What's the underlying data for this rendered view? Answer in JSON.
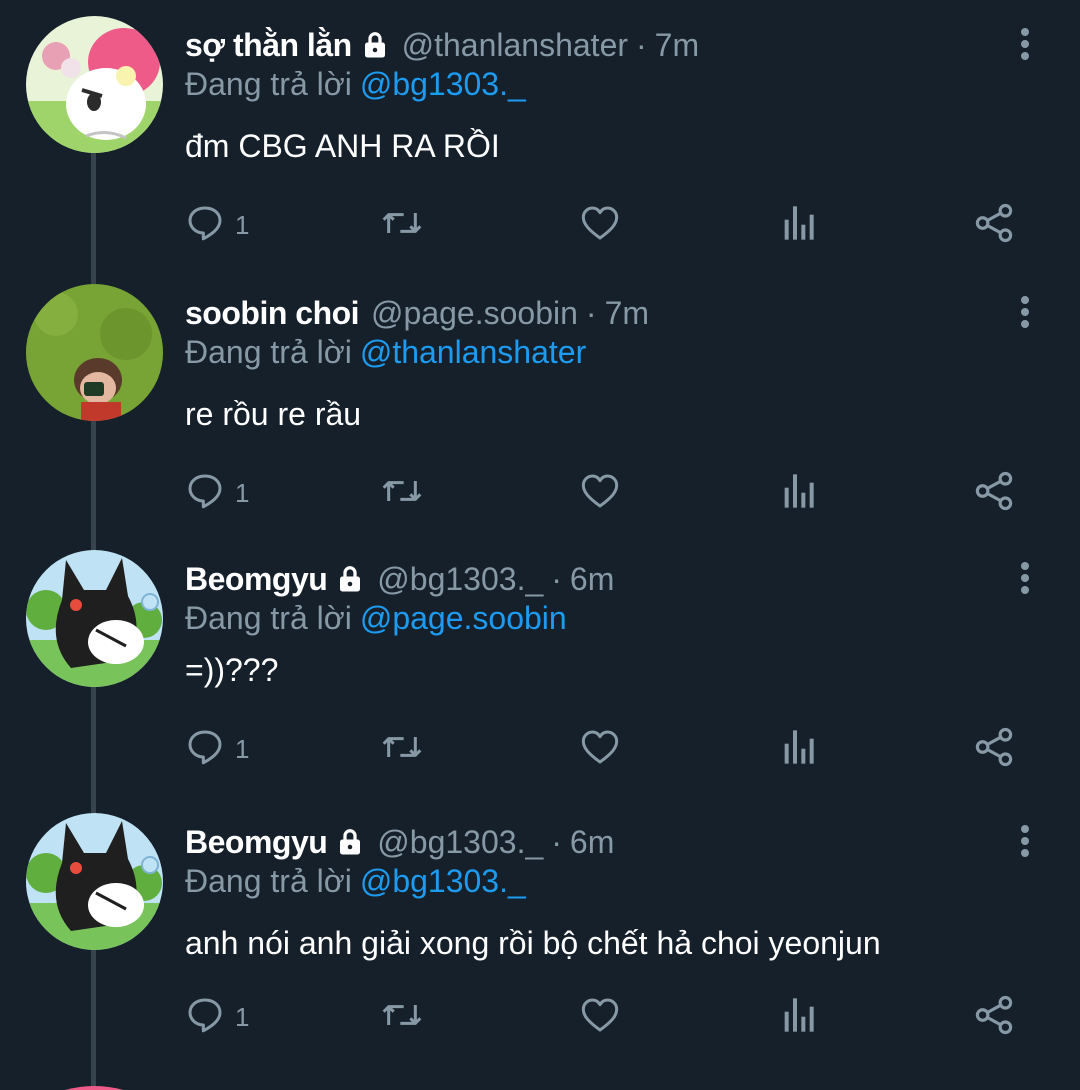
{
  "colors": {
    "background": "#15202b",
    "muted": "#8899a6",
    "link": "#1d9bf0",
    "thread_line": "#38444d"
  },
  "labels": {
    "replying_to": "Đang trả lời",
    "separator": "·"
  },
  "tweets": [
    {
      "display_name": "sợ thằn lằn",
      "locked": true,
      "handle": "@thanlanshater",
      "time": "7m",
      "reply_to": "@bg1303._",
      "text": "đm CBG ANH RA RỒI",
      "reply_count": "1",
      "avatar": "pink-bunny-avatar"
    },
    {
      "display_name": "soobin choi",
      "locked": false,
      "handle": "@page.soobin",
      "time": "7m",
      "reply_to": "@thanlanshater",
      "text": "re rồu re rầu",
      "reply_count": "1",
      "avatar": "grass-photo-avatar"
    },
    {
      "display_name": "Beomgyu",
      "locked": true,
      "handle": "@bg1303._",
      "time": "6m",
      "reply_to": "@page.soobin",
      "text": "=))???",
      "reply_count": "1",
      "avatar": "black-bunny-avatar"
    },
    {
      "display_name": "Beomgyu",
      "locked": true,
      "handle": "@bg1303._",
      "time": "6m",
      "reply_to": "@bg1303._",
      "text": "anh nói anh giải xong rồi bộ chết hả choi yeonjun",
      "reply_count": "1",
      "avatar": "black-bunny-avatar"
    }
  ],
  "icons": {
    "reply": "reply-icon",
    "retweet": "retweet-icon",
    "like": "heart-icon",
    "analytics": "analytics-icon",
    "share": "share-icon",
    "more": "more-vertical-icon",
    "lock": "lock-icon"
  }
}
